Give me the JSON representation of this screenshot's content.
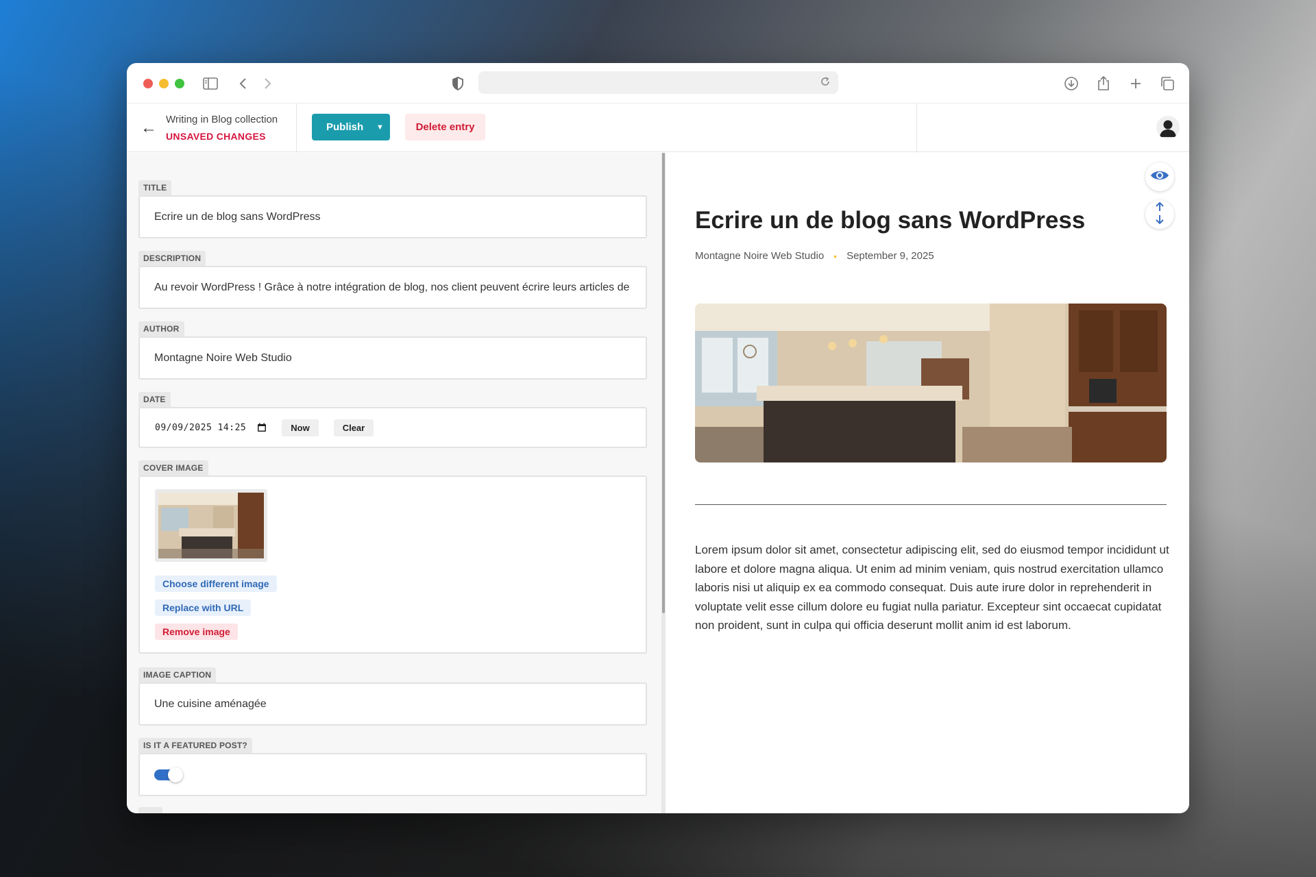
{
  "colors": {
    "accent": "#1a9cad",
    "danger": "#d01c35",
    "link_blue": "#3169b5",
    "toggle_on": "#3170c7",
    "meta_bullet": "#f3c33a"
  },
  "browser": {
    "icons": [
      "sidebar-icon",
      "back-icon",
      "forward-icon",
      "shield-icon",
      "reload-icon",
      "download-icon",
      "share-icon",
      "new-tab-icon",
      "tabs-overview-icon"
    ]
  },
  "header": {
    "collection_label": "Writing in Blog collection",
    "status": "UNSAVED CHANGES",
    "publish_label": "Publish",
    "delete_label": "Delete entry"
  },
  "editor": {
    "title": {
      "label": "TITLE",
      "value": "Ecrire un de blog sans WordPress"
    },
    "description": {
      "label": "DESCRIPTION",
      "value": "Au revoir WordPress ! Grâce à notre intégration de blog, nos client peuvent écrire leurs articles de"
    },
    "author": {
      "label": "AUTHOR",
      "value": "Montagne Noire Web Studio"
    },
    "date": {
      "label": "DATE",
      "value": "09/09/2025  14:25",
      "now_label": "Now",
      "clear_label": "Clear"
    },
    "cover_image": {
      "label": "COVER IMAGE",
      "choose_label": "Choose different image",
      "replace_label": "Replace with URL",
      "remove_label": "Remove image"
    },
    "image_caption": {
      "label": "IMAGE CAPTION",
      "value": "Une cuisine aménagée"
    },
    "featured": {
      "label": "IS IT A FEATURED POST?",
      "value": true
    }
  },
  "preview": {
    "title": "Ecrire un de blog sans WordPress",
    "author": "Montagne Noire Web Studio",
    "date": "September 9, 2025",
    "body": "Lorem ipsum dolor sit amet, consectetur adipiscing elit, sed do eiusmod tempor incididunt ut labore et dolore magna aliqua. Ut enim ad minim veniam, quis nostrud exercitation ullamco laboris nisi ut aliquip ex ea commodo consequat. Duis aute irure dolor in reprehenderit in voluptate velit esse cillum dolore eu fugiat nulla pariatur. Excepteur sint occaecat cupidatat non proident, sunt in culpa qui officia deserunt mollit anim id est laborum."
  }
}
